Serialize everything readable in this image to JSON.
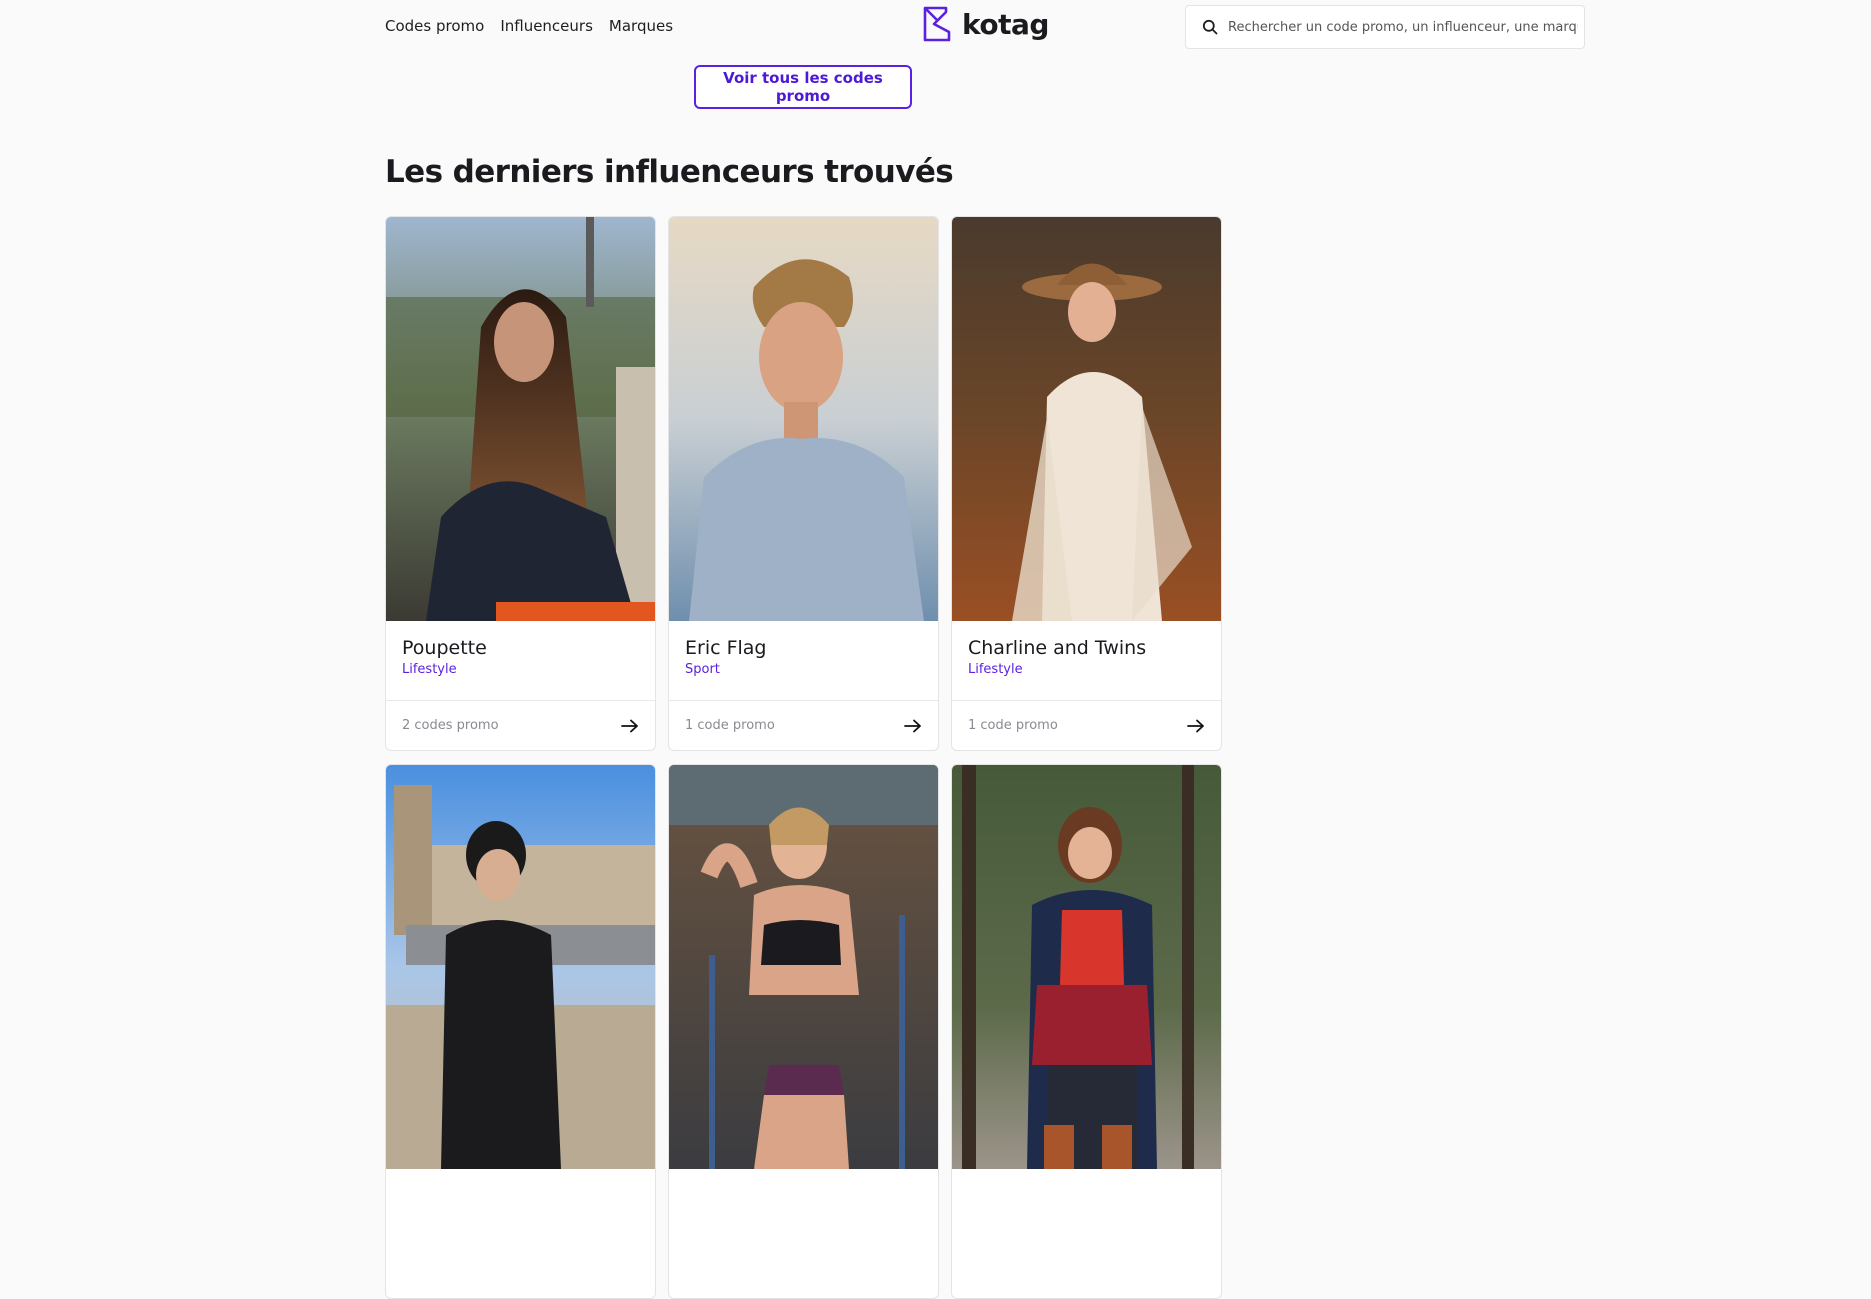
{
  "nav": {
    "items": [
      "Codes promo",
      "Influenceurs",
      "Marques"
    ]
  },
  "brand": {
    "name": "kotag",
    "color": "#5b21e0"
  },
  "search": {
    "placeholder": "Rechercher un code promo, un influenceur, une marque.",
    "icon": "search-icon"
  },
  "promo": {
    "all_codes_label": "Voir tous les codes promo"
  },
  "section": {
    "title": "Les derniers influenceurs trouvés"
  },
  "influencers": [
    {
      "name": "Poupette",
      "category": "Lifestyle",
      "codes": "2 codes promo"
    },
    {
      "name": "Eric Flag",
      "category": "Sport",
      "codes": "1 code promo"
    },
    {
      "name": "Charline and Twins",
      "category": "Lifestyle",
      "codes": "1 code promo"
    },
    {
      "name": "",
      "category": "",
      "codes": ""
    },
    {
      "name": "",
      "category": "",
      "codes": ""
    },
    {
      "name": "",
      "category": "",
      "codes": ""
    }
  ],
  "colors": {
    "accent": "#5b21e0",
    "text": "#1f1f23",
    "muted": "#8a8a92",
    "background": "#fafafa"
  }
}
